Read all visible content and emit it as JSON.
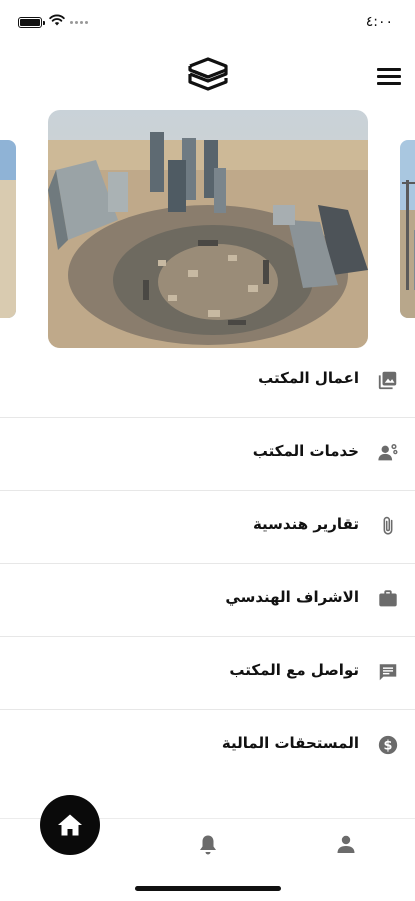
{
  "status_bar": {
    "time": "٤:٠٠"
  },
  "header": {
    "logo_icon": "stacked-s-logo-icon",
    "menu_icon": "hamburger-menu-icon"
  },
  "carousel": {
    "active_index": 1,
    "total_visible": 3
  },
  "menu": {
    "items": [
      {
        "label": "اعمال المكتب",
        "icon": "image-gallery-icon"
      },
      {
        "label": "خدمات المكتب",
        "icon": "people-service-icon"
      },
      {
        "label": "تقارير هندسية",
        "icon": "paperclip-icon"
      },
      {
        "label": "الاشراف الهندسي",
        "icon": "briefcase-icon"
      },
      {
        "label": "تواصل مع المكتب",
        "icon": "chat-icon"
      },
      {
        "label": "المستحقات المالية",
        "icon": "dollar-circle-icon"
      }
    ]
  },
  "bottom_nav": {
    "items": [
      "home-icon",
      "bell-icon",
      "profile-icon"
    ],
    "active": "home-icon"
  },
  "colors": {
    "primary": "#0a0a0a",
    "icon_gray": "#6b6b6b",
    "divider": "#e7e7e7"
  }
}
